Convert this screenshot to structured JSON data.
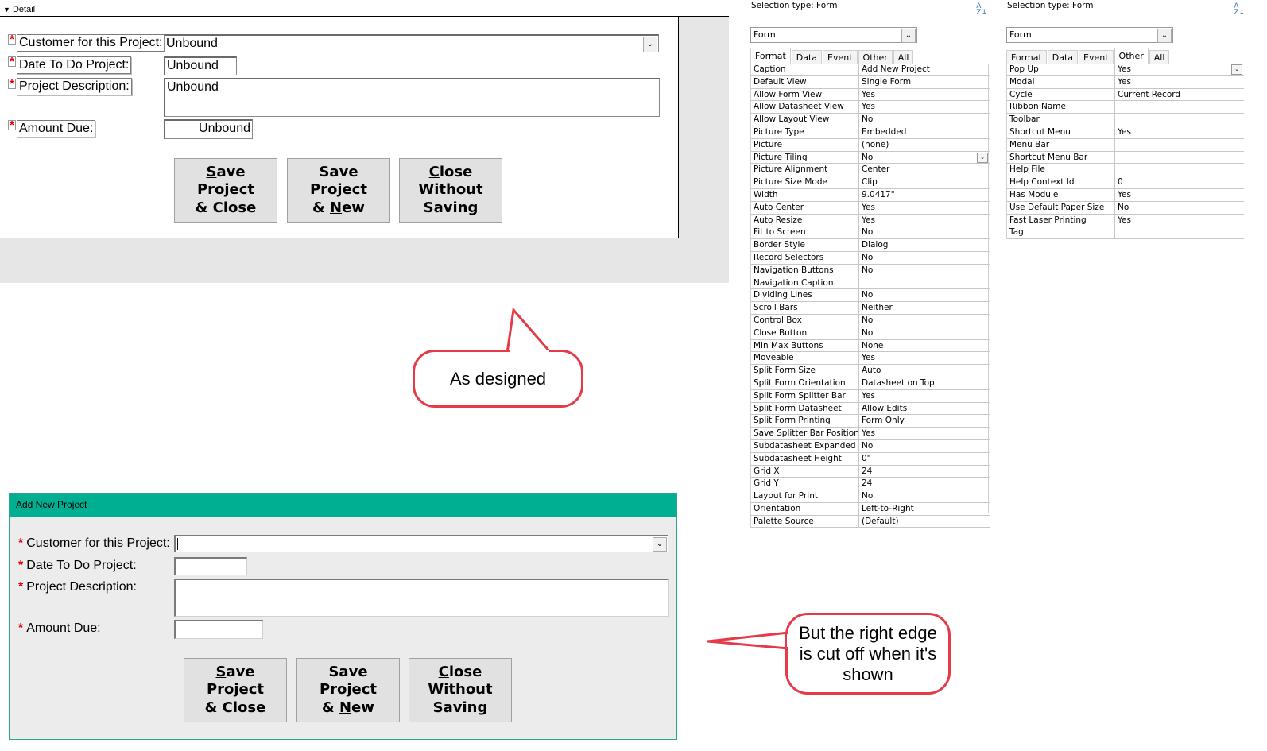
{
  "design": {
    "section_label": "Detail",
    "labels": {
      "customer": "Customer for this Project:",
      "date": "Date To Do Project:",
      "description": "Project Description:",
      "amount": "Amount Due:"
    },
    "values": {
      "customer": "Unbound",
      "date": "Unbound",
      "description": "Unbound",
      "amount": "Unbound"
    },
    "required_mark": "*",
    "buttons": {
      "save_close": {
        "hot": "S",
        "line1_rest": "ave",
        "line2": "Project",
        "line3": "& Close"
      },
      "save_new": {
        "line1": "Save",
        "line2": "Project",
        "line3_pre": "& ",
        "hot": "N",
        "line3_rest": "ew"
      },
      "close": {
        "hot": "C",
        "line1_rest": "lose",
        "line2": "Without",
        "line3": "Saving"
      }
    }
  },
  "callouts": {
    "designed": "As designed",
    "cut_off": "But the right edge is cut off when it's shown"
  },
  "runtime": {
    "title": "Add New Project",
    "required_mark": "*",
    "labels": {
      "customer": "Customer for this Project:",
      "date": "Date To Do Project:",
      "description": "Project Description:",
      "amount": "Amount Due:"
    },
    "buttons": {
      "save_close": {
        "hot": "S",
        "line1_rest": "ave",
        "line2": "Project",
        "line3": "& Close"
      },
      "save_new": {
        "line1": "Save",
        "line2": "Project",
        "line3_pre": "& ",
        "hot": "N",
        "line3_rest": "ew"
      },
      "close": {
        "hot": "C",
        "line1_rest": "lose",
        "line2": "Without",
        "line3": "Saving"
      }
    }
  },
  "sheet_format": {
    "selection_type": "Selection type:  Form",
    "object": "Form",
    "tabs": [
      "Format",
      "Data",
      "Event",
      "Other",
      "All"
    ],
    "active_tab": "Format",
    "rows": [
      [
        "Caption",
        "Add New Project"
      ],
      [
        "Default View",
        "Single Form"
      ],
      [
        "Allow Form View",
        "Yes"
      ],
      [
        "Allow Datasheet View",
        "Yes"
      ],
      [
        "Allow Layout View",
        "No"
      ],
      [
        "Picture Type",
        "Embedded"
      ],
      [
        "Picture",
        "(none)"
      ],
      [
        "Picture Tiling",
        "No"
      ],
      [
        "Picture Alignment",
        "Center"
      ],
      [
        "Picture Size Mode",
        "Clip"
      ],
      [
        "Width",
        "9.0417\""
      ],
      [
        "Auto Center",
        "Yes"
      ],
      [
        "Auto Resize",
        "Yes"
      ],
      [
        "Fit to Screen",
        "No"
      ],
      [
        "Border Style",
        "Dialog"
      ],
      [
        "Record Selectors",
        "No"
      ],
      [
        "Navigation Buttons",
        "No"
      ],
      [
        "Navigation Caption",
        ""
      ],
      [
        "Dividing Lines",
        "No"
      ],
      [
        "Scroll Bars",
        "Neither"
      ],
      [
        "Control Box",
        "No"
      ],
      [
        "Close Button",
        "No"
      ],
      [
        "Min Max Buttons",
        "None"
      ],
      [
        "Moveable",
        "Yes"
      ],
      [
        "Split Form Size",
        "Auto"
      ],
      [
        "Split Form Orientation",
        "Datasheet on Top"
      ],
      [
        "Split Form Splitter Bar",
        "Yes"
      ],
      [
        "Split Form Datasheet",
        "Allow Edits"
      ],
      [
        "Split Form Printing",
        "Form Only"
      ],
      [
        "Save Splitter Bar Position",
        "Yes"
      ],
      [
        "Subdatasheet Expanded",
        "No"
      ],
      [
        "Subdatasheet Height",
        "0\""
      ],
      [
        "Grid X",
        "24"
      ],
      [
        "Grid Y",
        "24"
      ],
      [
        "Layout for Print",
        "No"
      ],
      [
        "Orientation",
        "Left-to-Right"
      ],
      [
        "Palette Source",
        "(Default)"
      ]
    ]
  },
  "sheet_other": {
    "selection_type": "Selection type:  Form",
    "object": "Form",
    "tabs": [
      "Format",
      "Data",
      "Event",
      "Other",
      "All"
    ],
    "active_tab": "Other",
    "rows": [
      [
        "Pop Up",
        "Yes"
      ],
      [
        "Modal",
        "Yes"
      ],
      [
        "Cycle",
        "Current Record"
      ],
      [
        "Ribbon Name",
        ""
      ],
      [
        "Toolbar",
        ""
      ],
      [
        "Shortcut Menu",
        "Yes"
      ],
      [
        "Menu Bar",
        ""
      ],
      [
        "Shortcut Menu Bar",
        ""
      ],
      [
        "Help File",
        ""
      ],
      [
        "Help Context Id",
        "0"
      ],
      [
        "Has Module",
        "Yes"
      ],
      [
        "Use Default Paper Size",
        "No"
      ],
      [
        "Fast Laser Printing",
        "Yes"
      ],
      [
        "Tag",
        ""
      ]
    ]
  }
}
